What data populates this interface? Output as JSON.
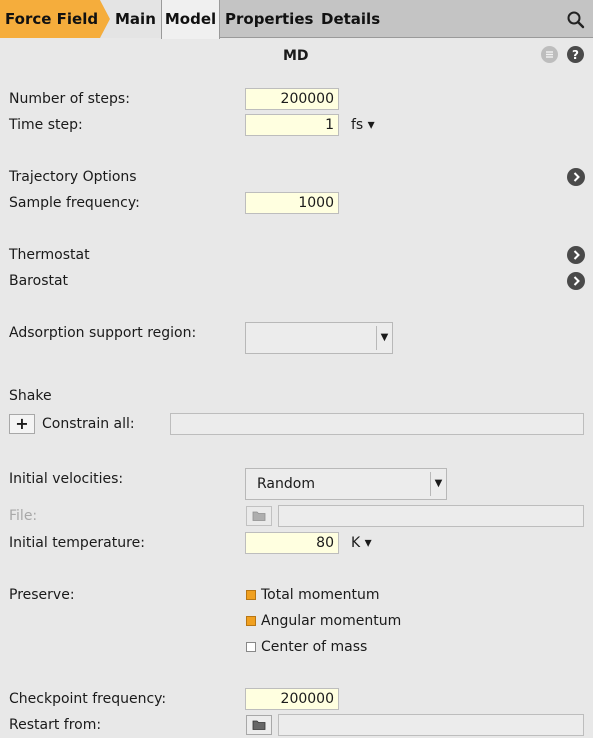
{
  "tabs": {
    "force_field": "Force Field",
    "main": "Main",
    "model": "Model",
    "properties": "Properties",
    "details": "Details"
  },
  "header": {
    "title": "MD"
  },
  "fields": {
    "num_steps_label": "Number of steps:",
    "num_steps_value": "200000",
    "time_step_label": "Time step:",
    "time_step_value": "1",
    "time_step_unit": "fs ▾",
    "trajectory_label": "Trajectory Options",
    "sample_freq_label": "Sample frequency:",
    "sample_freq_value": "1000",
    "thermostat_label": "Thermostat",
    "barostat_label": "Barostat",
    "adsorption_label": "Adsorption support region:",
    "adsorption_value": "",
    "shake_label": "Shake",
    "constrain_label": "Constrain all:",
    "constrain_value": "",
    "init_vel_label": "Initial velocities:",
    "init_vel_value": "Random",
    "file_label": "File:",
    "file_value": "",
    "init_temp_label": "Initial temperature:",
    "init_temp_value": "80",
    "init_temp_unit": "K ▾",
    "preserve_label": "Preserve:",
    "checkpoint_label": "Checkpoint frequency:",
    "checkpoint_value": "200000",
    "restart_label": "Restart from:",
    "restart_value": ""
  },
  "preserve_options": [
    {
      "label": "Total momentum",
      "checked": true
    },
    {
      "label": "Angular momentum",
      "checked": true
    },
    {
      "label": "Center of mass",
      "checked": false
    }
  ],
  "colors": {
    "active_tab": "#f5ad3c",
    "input_bg": "#ffffe0",
    "checkbox_on": "#f0a020"
  },
  "icons": {
    "search": "search-icon",
    "menu": "menu-icon",
    "help": "help-icon",
    "expand": "chevron-right-icon",
    "folder": "folder-icon",
    "add": "plus-icon"
  }
}
